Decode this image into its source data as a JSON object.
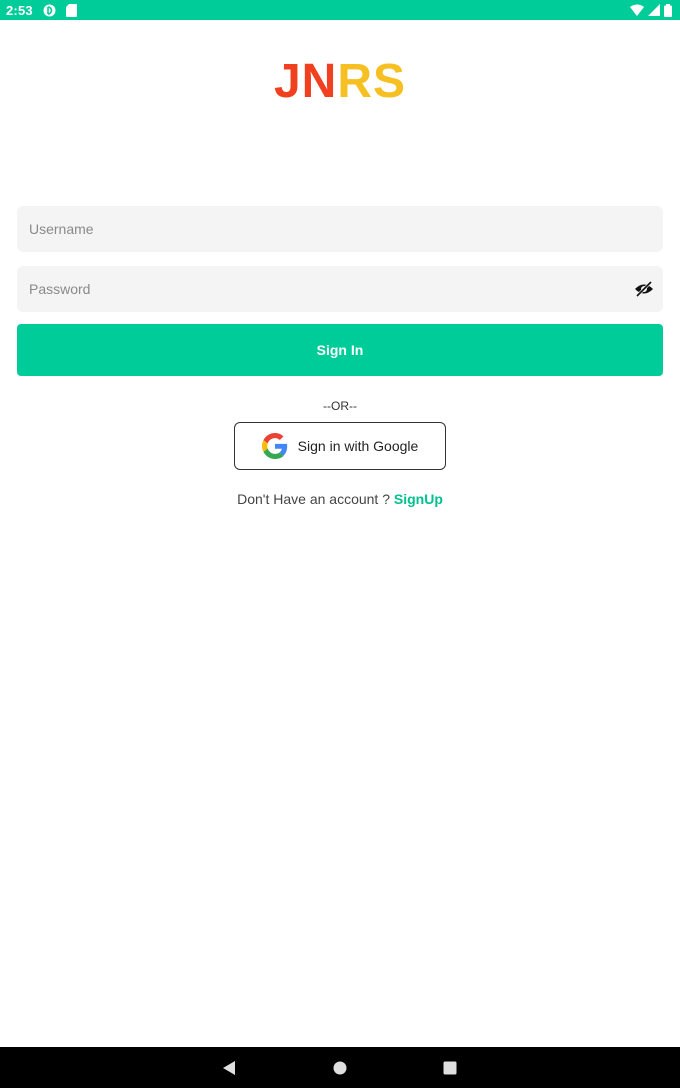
{
  "status_bar": {
    "time": "2:53",
    "icons": [
      "cast-icon",
      "sd-card-icon",
      "wifi-icon",
      "signal-icon",
      "battery-icon"
    ]
  },
  "logo": {
    "part_a": "JN",
    "part_b": "RS",
    "color_a": "#f0401f",
    "color_b": "#f6c023"
  },
  "form": {
    "username_placeholder": "Username",
    "username_value": "",
    "password_placeholder": "Password",
    "password_value": "",
    "sign_in_label": "Sign In",
    "or_text": "--OR--",
    "google_label": "Sign in with Google",
    "signup_prompt": "Don't Have an account ? ",
    "signup_link": "SignUp"
  },
  "colors": {
    "accent": "#00cc99",
    "field_bg": "#f4f4f4"
  },
  "nav": {
    "icons": [
      "back-icon",
      "home-icon",
      "recents-icon"
    ]
  }
}
